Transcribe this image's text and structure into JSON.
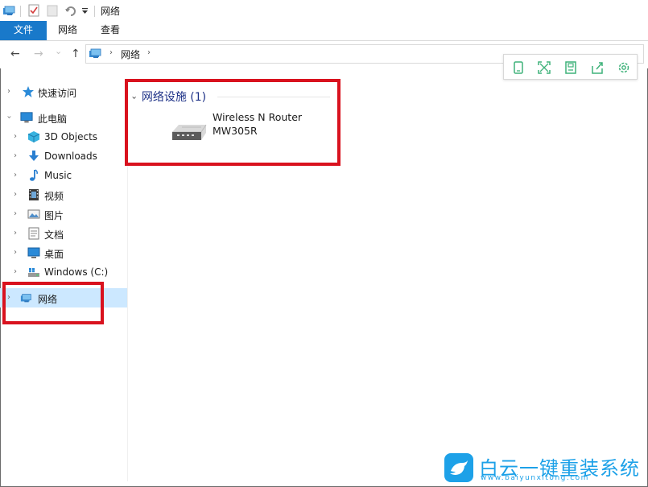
{
  "titlebar": {
    "title": "网络",
    "colors": {
      "accent": "#1979ca"
    }
  },
  "ribbon": {
    "tabs": [
      {
        "label": "文件",
        "active": true
      },
      {
        "label": "网络",
        "active": false
      },
      {
        "label": "查看",
        "active": false
      }
    ]
  },
  "navbar": {
    "back": "←",
    "forward": "→",
    "recent": "⌄",
    "up": "↑",
    "path": [
      "网络"
    ],
    "chevron": "›"
  },
  "floating_toolbar": {
    "icons": [
      "phone-icon",
      "fullscreen-icon",
      "save-icon",
      "share-icon",
      "settings-icon"
    ]
  },
  "navigation_pane": {
    "quick_access": "快速访问",
    "this_pc": "此电脑",
    "items": [
      {
        "label": "3D Objects",
        "icon": "3d-objects-icon"
      },
      {
        "label": "Downloads",
        "icon": "downloads-icon"
      },
      {
        "label": "Music",
        "icon": "music-icon"
      },
      {
        "label": "视频",
        "icon": "video-icon"
      },
      {
        "label": "图片",
        "icon": "pictures-icon"
      },
      {
        "label": "文档",
        "icon": "documents-icon"
      },
      {
        "label": "桌面",
        "icon": "desktop-icon"
      },
      {
        "label": "Windows (C:)",
        "icon": "drive-icon"
      }
    ],
    "network": "网络"
  },
  "content": {
    "group_header": "网络设施 (1)",
    "devices": [
      {
        "name_line1": "Wireless N Router",
        "name_line2": "MW305R",
        "icon": "router-icon"
      }
    ]
  },
  "watermark": {
    "title": "白云一键重装系统",
    "url": "www.baiyunxitong.com"
  }
}
